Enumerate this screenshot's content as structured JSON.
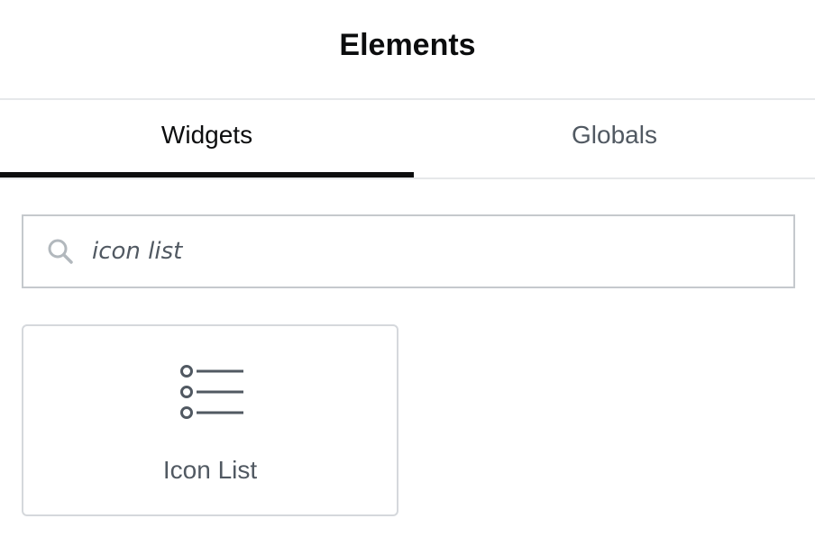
{
  "header": {
    "title": "Elements"
  },
  "tabs": [
    {
      "label": "Widgets",
      "active": true
    },
    {
      "label": "Globals",
      "active": false
    }
  ],
  "search": {
    "value": "icon list",
    "icon": "search-icon"
  },
  "widgets": [
    {
      "label": "Icon List",
      "icon": "icon-list-icon"
    }
  ],
  "colors": {
    "active_tab_underline": "#0c0d0e",
    "muted_text": "#515962",
    "border": "#c5c9cd"
  }
}
